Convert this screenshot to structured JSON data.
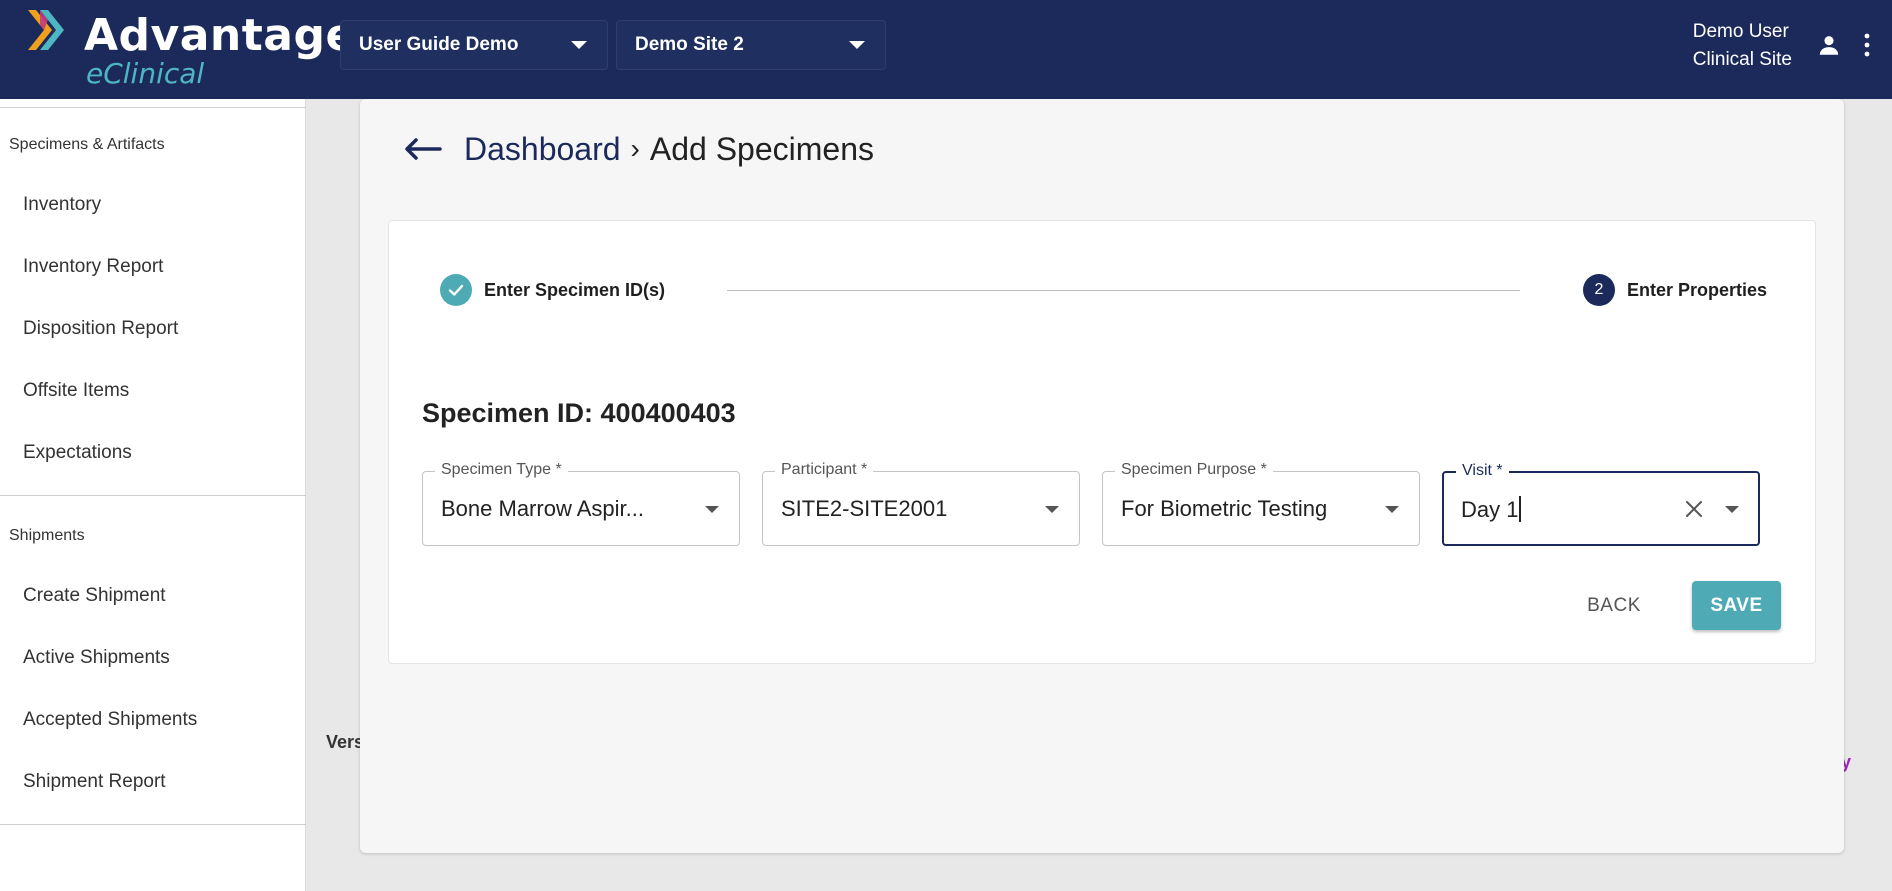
{
  "brand": {
    "title": "Advantage",
    "subtitle": "eClinical"
  },
  "header": {
    "study_selector": "User Guide Demo",
    "site_selector": "Demo Site 2",
    "user_name": "Demo User",
    "user_role": "Clinical Site",
    "icons": [
      "person-icon",
      "more-vert-icon"
    ]
  },
  "sidebar": {
    "sections": [
      {
        "label": "Specimens & Artifacts",
        "items": [
          "Inventory",
          "Inventory Report",
          "Disposition Report",
          "Offsite Items",
          "Expectations"
        ]
      },
      {
        "label": "Shipments",
        "items": [
          "Create Shipment",
          "Active Shipments",
          "Accepted Shipments",
          "Shipment Report"
        ]
      }
    ]
  },
  "breadcrumb": {
    "link": "Dashboard",
    "separator": "›",
    "current": "Add Specimens"
  },
  "stepper": {
    "step1": "Enter Specimen ID(s)",
    "step2_number": "2",
    "step2": "Enter Properties"
  },
  "form": {
    "specimen_id_label": "Specimen ID: 400400403",
    "fields": {
      "specimen_type": {
        "label": "Specimen Type *",
        "value": "Bone Marrow Aspir..."
      },
      "participant": {
        "label": "Participant *",
        "value": "SITE2-SITE2001"
      },
      "specimen_purpose": {
        "label": "Specimen Purpose *",
        "value": "For Biometric Testing"
      },
      "visit": {
        "label": "Visit *",
        "value": "Day 1"
      }
    },
    "back_label": "BACK",
    "save_label": "SAVE"
  },
  "footer": {
    "version_partial": "Vers",
    "right_partial": "ny"
  },
  "colors": {
    "header_bg": "#1b2a5a",
    "accent_teal": "#4eaab5",
    "footer_link": "#9c27b0"
  }
}
